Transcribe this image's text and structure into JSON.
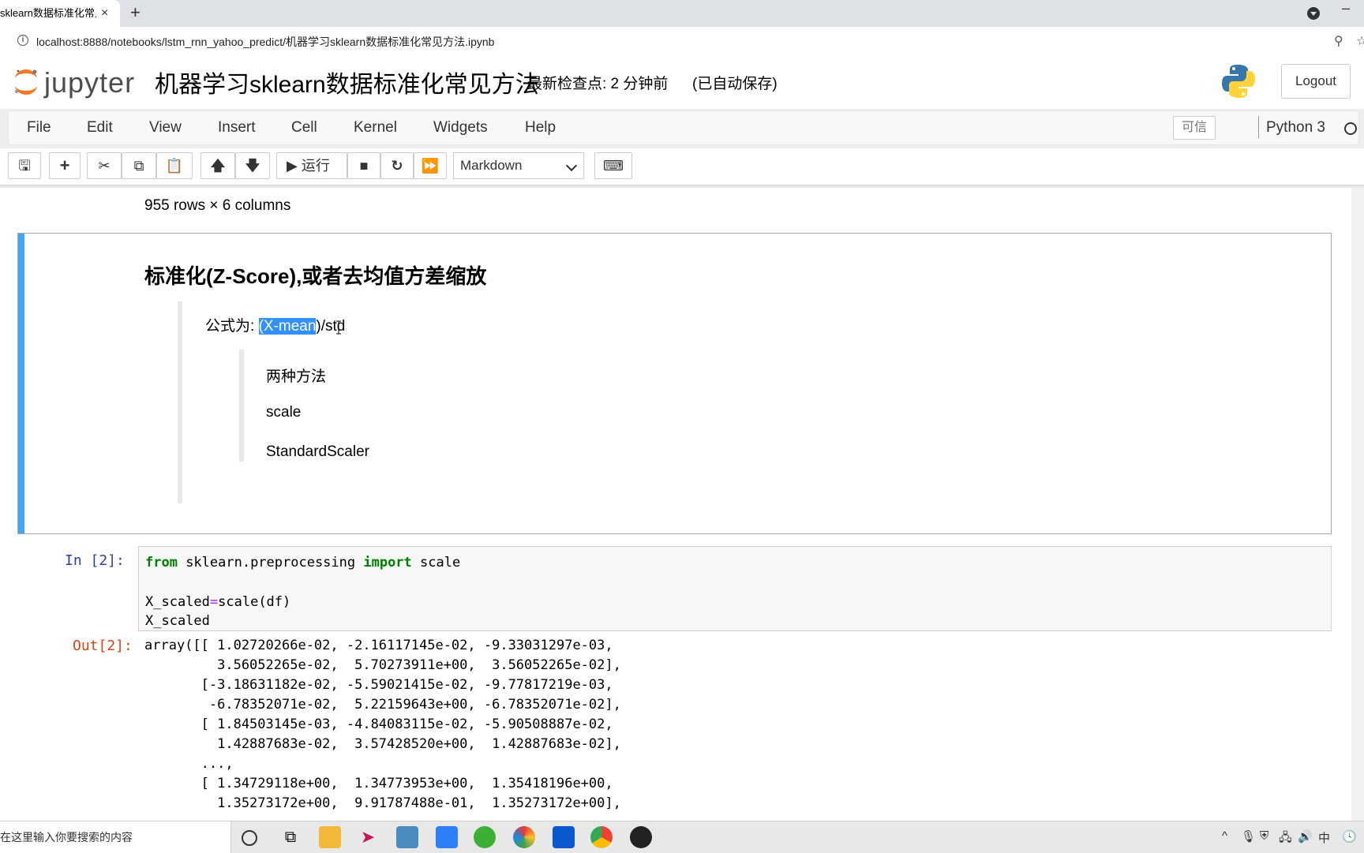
{
  "browser": {
    "tab_title": "sklearn数据标准化常见",
    "tab_close": "×",
    "new_tab": "+",
    "url": "localhost:8888/notebooks/lstm_rnn_yahoo_predict/机器学习sklearn数据标准化常见方法.ipynb"
  },
  "header": {
    "logo_text": "jupyter",
    "notebook_title": "机器学习sklearn数据标准化常见方法",
    "checkpoint": "最新检查点: 2 分钟前",
    "autosave": "(已自动保存)",
    "logout_label": "Logout"
  },
  "menubar": {
    "items": [
      "File",
      "Edit",
      "View",
      "Insert",
      "Cell",
      "Kernel",
      "Widgets",
      "Help"
    ],
    "trusted": "可信",
    "kernel": "Python 3"
  },
  "toolbar": {
    "run_label": "运行",
    "cell_type": "Markdown"
  },
  "notebook": {
    "row_count": "955 rows × 6 columns",
    "markdown": {
      "heading": "标准化(Z-Score),或者去均值方差缩放",
      "formula_prefix": "公式为:",
      "formula_highlight": "(X-mean",
      "formula_suffix": ")/std",
      "item1": "两种方法",
      "item2": "scale",
      "item3": "StandardScaler"
    },
    "code_cell": {
      "prompt": "In  [2]:",
      "line1_kw1": "from",
      "line1_mid": " sklearn.preprocessing ",
      "line1_kw2": "import",
      "line1_end": " scale",
      "line2_a": "X_scaled",
      "line2_op": "=",
      "line2_b": "scale(df)",
      "line3": "X_scaled"
    },
    "output": {
      "prompt": "Out[2]:",
      "lines": [
        "array([[ 1.02720266e-02, -2.16117145e-02, -9.33031297e-03,",
        "         3.56052265e-02,  5.70273911e+00,  3.56052265e-02],",
        "       [-3.18631182e-02, -5.59021415e-02, -9.77817219e-03,",
        "        -6.78352071e-02,  5.22159643e+00, -6.78352071e-02],",
        "       [ 1.84503145e-03, -4.84083115e-02, -5.90508887e-02,",
        "         1.42887683e-02,  3.57428520e+00,  1.42887683e-02],",
        "       ...,",
        "       [ 1.34729118e+00,  1.34773953e+00,  1.35418196e+00,",
        "         1.35273172e+00,  9.91787488e-01,  1.35273172e+00],"
      ]
    }
  },
  "taskbar": {
    "search_text": "在这里输入你要搜索的内容"
  }
}
